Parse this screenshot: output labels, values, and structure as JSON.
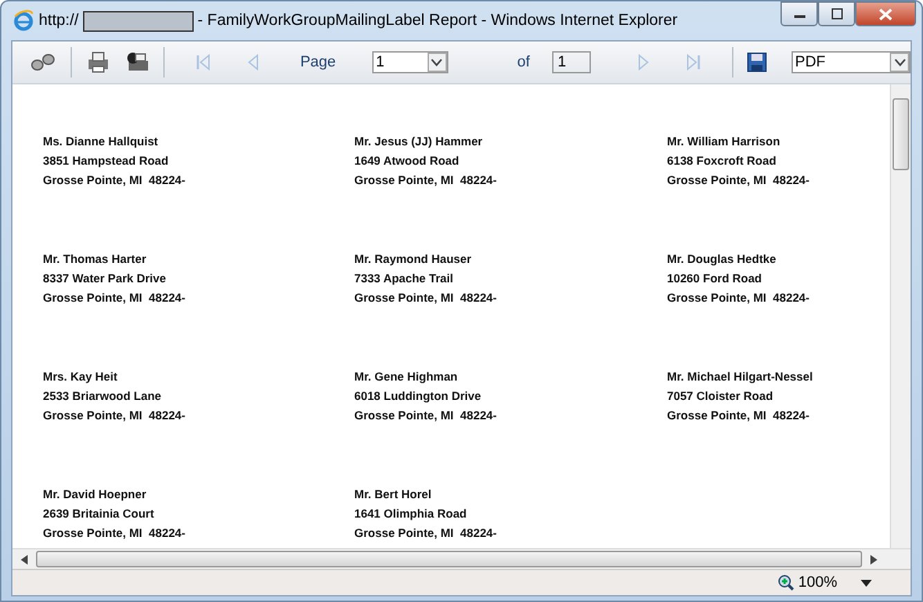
{
  "window": {
    "title_prefix": "http://",
    "title": "- FamilyWorkGroupMailingLabel Report - Windows Internet Explorer"
  },
  "toolbar": {
    "nav_buttons": [
      {
        "kind": "first",
        "disabled": true
      },
      {
        "kind": "previous",
        "disabled": true
      },
      {
        "kind": "next",
        "disabled": true
      },
      {
        "kind": "last",
        "disabled": true
      }
    ],
    "page_label": "Page",
    "page_value": "1",
    "of_label": "of",
    "page_count": "1",
    "export_format": "PDF"
  },
  "labels": [
    {
      "lines": [
        "Ms. Dianne Hallquist",
        "3851 Hampstead Road",
        "Grosse Pointe, MI  48224-"
      ]
    },
    {
      "lines": [
        "Mr. Jesus (JJ) Hammer",
        "1649 Atwood Road",
        "Grosse Pointe, MI  48224-"
      ]
    },
    {
      "lines": [
        "Mr. William Harrison",
        "6138 Foxcroft Road",
        "Grosse Pointe, MI  48224-"
      ]
    },
    {
      "lines": [
        "Mr. Thomas Harter",
        "8337 Water Park Drive",
        "Grosse Pointe, MI  48224-"
      ]
    },
    {
      "lines": [
        "Mr. Raymond Hauser",
        "7333 Apache Trail",
        "Grosse Pointe, MI  48224-"
      ]
    },
    {
      "lines": [
        "Mr. Douglas Hedtke",
        "10260 Ford Road",
        "Grosse Pointe, MI  48224-"
      ]
    },
    {
      "lines": [
        "Mrs. Kay Heit",
        "2533 Briarwood Lane",
        "Grosse Pointe, MI  48224-"
      ]
    },
    {
      "lines": [
        "Mr. Gene Highman",
        "6018 Luddington Drive",
        "Grosse Pointe, MI  48224-"
      ]
    },
    {
      "lines": [
        "Mr. Michael Hilgart-Nessel",
        "7057 Cloister Road",
        "Grosse Pointe, MI  48224-"
      ]
    },
    {
      "lines": [
        "Mr. David Hoepner",
        "2639 Britainia Court",
        "Grosse Pointe, MI  48224-"
      ]
    },
    {
      "lines": [
        "Mr. Bert Horel",
        "1641 Olimphia Road",
        "Grosse Pointe, MI  48224-"
      ]
    }
  ],
  "status_bar": {
    "zoom": "100%"
  }
}
